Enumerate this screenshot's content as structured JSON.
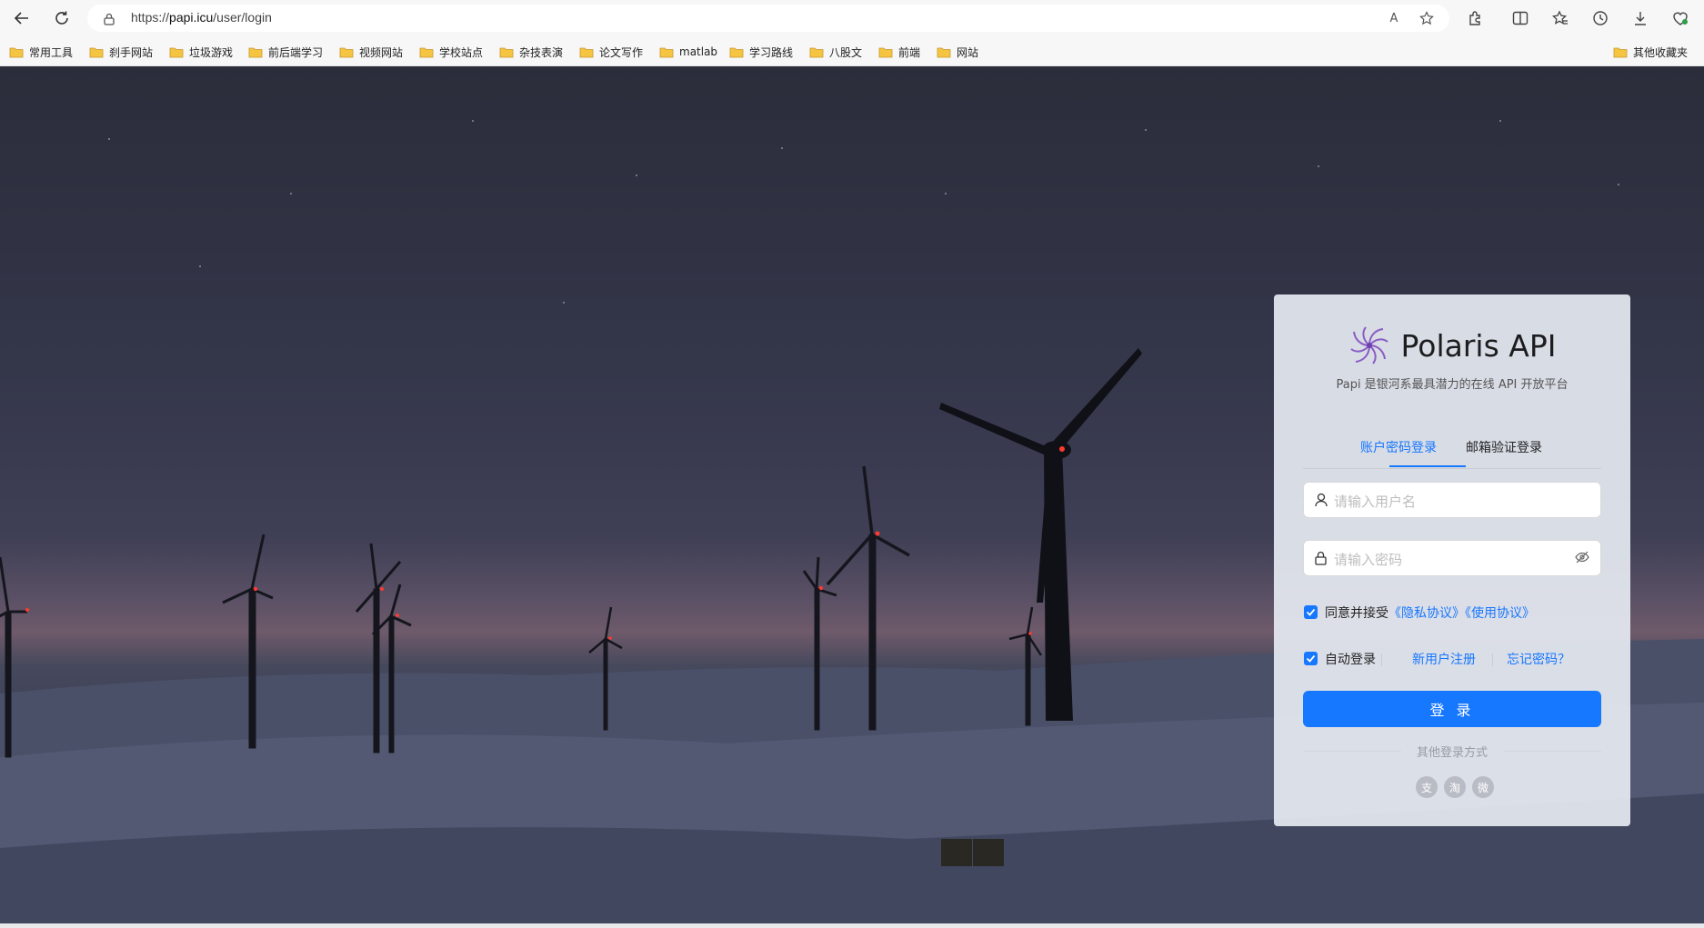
{
  "browser": {
    "url_scheme": "https://",
    "url_host": "papi.icu",
    "url_path": "/user/login",
    "read_aloud_label": "A"
  },
  "bookmarks": {
    "items": [
      "常用工具",
      "刹手网站",
      "垃圾游戏",
      "前后端学习",
      "视频网站",
      "学校站点",
      "杂技表演",
      "论文写作",
      "matlab",
      "学习路线",
      "八股文",
      "前端",
      "网站"
    ],
    "other": "其他收藏夹"
  },
  "login": {
    "brand": "Polaris API",
    "subtitle": "Papi 是银河系最具潜力的在线 API 开放平台",
    "tabs": [
      "账户密码登录",
      "邮箱验证登录"
    ],
    "active_tab": 0,
    "username_placeholder": "请输入用户名",
    "password_placeholder": "请输入密码",
    "agree_prefix": "同意并接受",
    "privacy_link": "《隐私协议》",
    "terms_link": "《使用协议》",
    "agree_checked": true,
    "auto_login_label": "自动登录",
    "auto_login_checked": true,
    "register_link": "新用户注册",
    "forgot_link": "忘记密码？",
    "submit": "登 录",
    "other_methods": "其他登录方式",
    "social": [
      "支",
      "淘",
      "微"
    ]
  },
  "colors": {
    "primary": "#1677ff",
    "card_bg": "#e6eaf2"
  }
}
